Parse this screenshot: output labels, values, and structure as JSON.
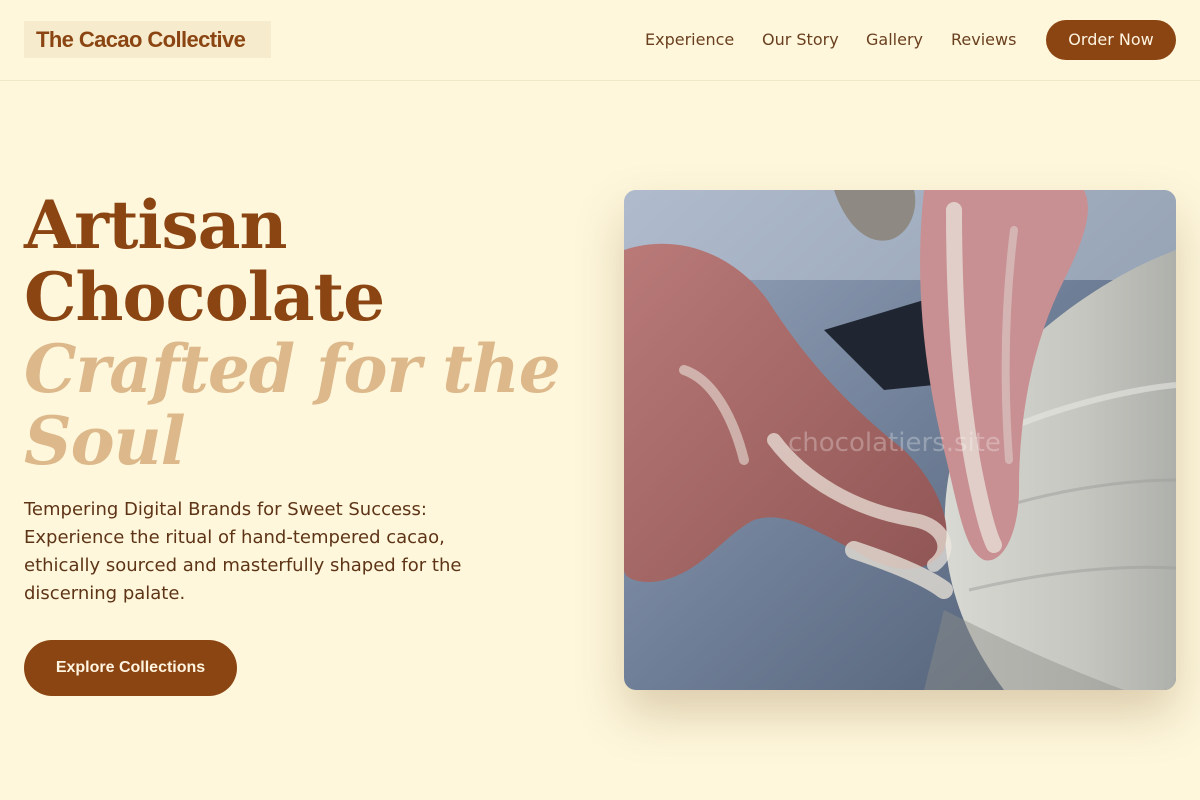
{
  "header": {
    "logo": "The Cacao Collective",
    "nav": [
      "Experience",
      "Our Story",
      "Gallery",
      "Reviews"
    ],
    "cta_label": "Order Now"
  },
  "hero": {
    "headline_lines": [
      "Artisan",
      "Chocolate"
    ],
    "accent_lines": [
      "Crafted for the",
      "Soul"
    ],
    "description": "Tempering Digital Brands for Sweet Success: Experience the ritual of hand-tempered cacao, ethically sourced and masterfully shaped for the discerning palate.",
    "button_label": "Explore Collections",
    "image_watermark": "chocolatiers.site"
  },
  "colors": {
    "background": "#fef7dc",
    "brand": "#8b4513",
    "accent": "#dcb88a",
    "text": "#5e3416"
  }
}
